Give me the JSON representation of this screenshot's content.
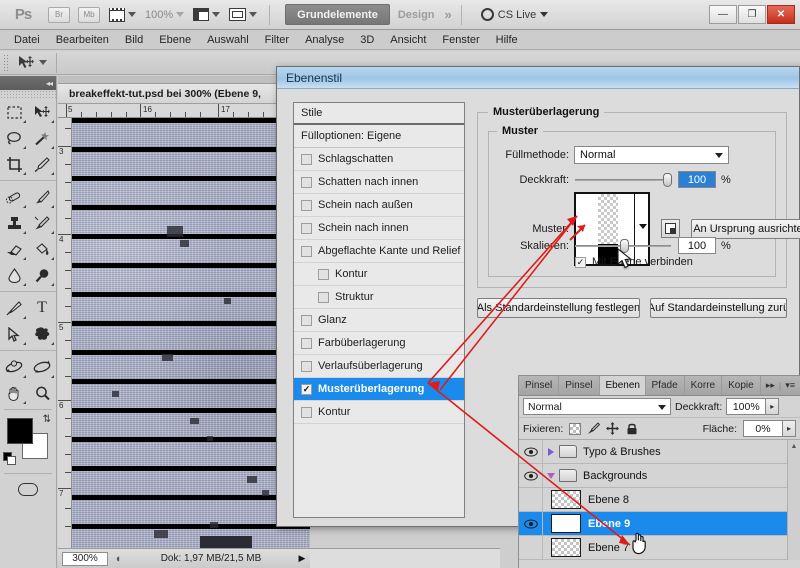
{
  "app": {
    "logo": "Ps",
    "bridge_label": "Br",
    "minibridge_label": "Mb",
    "zoom_label": "100%",
    "workspace_active": "Grundelemente",
    "workspace_other": "Design",
    "workspace_more": "»",
    "cslive_label": "CS Live",
    "win_minimize": "—",
    "win_restore": "❐",
    "win_close": "✕"
  },
  "menubar": {
    "items": [
      "Datei",
      "Bearbeiten",
      "Bild",
      "Ebene",
      "Auswahl",
      "Filter",
      "Analyse",
      "3D",
      "Ansicht",
      "Fenster",
      "Hilfe"
    ]
  },
  "toolbar": {
    "collapse_icon": "◂◂",
    "tools": [
      "rectangular-marquee-tool",
      "move-tool",
      "lasso-tool",
      "magic-wand-tool",
      "crop-tool",
      "eyedropper-tool",
      "spot-healing-brush-tool",
      "brush-tool",
      "clone-stamp-tool",
      "history-brush-tool",
      "eraser-tool",
      "paint-bucket-tool",
      "blur-tool",
      "dodge-tool",
      "pen-tool",
      "horizontal-type-tool",
      "path-selection-tool",
      "custom-shape-tool",
      "3d-rotate-tool",
      "3d-orbit-tool",
      "hand-tool",
      "zoom-tool"
    ],
    "foreground_color": "#000000",
    "background_color": "#ffffff"
  },
  "document": {
    "tab_title": "breakeffekt-tut.psd bei 300% (Ebene 9,",
    "ruler_h_labels": [
      "5",
      "16",
      "17"
    ],
    "ruler_v_labels": [
      "3",
      "4",
      "5",
      "6",
      "7"
    ],
    "zoom_value": "300%",
    "status_text": "Dok: 1,97 MB/21,5 MB",
    "status_arrow": "▶"
  },
  "dialog": {
    "title": "Ebenenstil",
    "styles": {
      "header": "Stile",
      "fill_options": "Fülloptionen: Eigene",
      "items": [
        {
          "label": "Schlagschatten",
          "checked": false,
          "indent": false,
          "selected": false
        },
        {
          "label": "Schatten nach innen",
          "checked": false,
          "indent": false,
          "selected": false
        },
        {
          "label": "Schein nach außen",
          "checked": false,
          "indent": false,
          "selected": false
        },
        {
          "label": "Schein nach innen",
          "checked": false,
          "indent": false,
          "selected": false
        },
        {
          "label": "Abgeflachte Kante und Relief",
          "checked": false,
          "indent": false,
          "selected": false
        },
        {
          "label": "Kontur",
          "checked": false,
          "indent": true,
          "selected": false
        },
        {
          "label": "Struktur",
          "checked": false,
          "indent": true,
          "selected": false
        },
        {
          "label": "Glanz",
          "checked": false,
          "indent": false,
          "selected": false
        },
        {
          "label": "Farbüberlagerung",
          "checked": false,
          "indent": false,
          "selected": false
        },
        {
          "label": "Verlaufsüberlagerung",
          "checked": false,
          "indent": false,
          "selected": false
        },
        {
          "label": "Musterüberlagerung",
          "checked": true,
          "indent": false,
          "selected": true
        },
        {
          "label": "Kontur",
          "checked": false,
          "indent": false,
          "selected": false
        }
      ],
      "checkmark": "✓"
    },
    "pattern_overlay": {
      "group_legend": "Musterüberlagerung",
      "subgroup_legend": "Muster",
      "blend_mode_label": "Füllmethode:",
      "blend_mode_value": "Normal",
      "opacity_label": "Deckkraft:",
      "opacity_value": "100",
      "opacity_unit": "%",
      "pattern_label": "Muster:",
      "new_pattern_icon": "new-pattern-icon",
      "snap_button": "An Ursprung ausrichten",
      "scale_label": "Skalieren:",
      "scale_value": "100",
      "scale_unit": "%",
      "link_layer_label": "Mit Ebene verbinden",
      "link_layer_checked": true
    },
    "buttons": {
      "set_default": "Als Standardeinstellung festlegen",
      "reset_default": "Auf Standardeinstellung zurü"
    }
  },
  "layers_panel": {
    "tabs": [
      {
        "label": "Pinsel",
        "active": false
      },
      {
        "label": "Pinsel",
        "active": false
      },
      {
        "label": "Ebenen",
        "active": true
      },
      {
        "label": "Pfade",
        "active": false
      },
      {
        "label": "Korre",
        "active": false
      },
      {
        "label": "Kopie",
        "active": false
      }
    ],
    "tab_expand": "▸▸",
    "tab_menu": "▾≡",
    "blend_mode": "Normal",
    "opacity_label": "Deckkraft:",
    "opacity_value": "100%",
    "lock_label": "Fixieren:",
    "fill_label": "Fläche:",
    "fill_value": "0%",
    "lock_icons": [
      "lock-transparency-icon",
      "lock-image-icon",
      "lock-position-icon",
      "lock-all-icon"
    ],
    "rows": [
      {
        "name": "Typo & Brushes",
        "type": "group",
        "visible": true,
        "expanded": false,
        "selected": false
      },
      {
        "name": "Backgrounds",
        "type": "group",
        "visible": true,
        "expanded": true,
        "selected": false
      },
      {
        "name": "Ebene 8",
        "type": "layer",
        "visible": false,
        "thumb": "checker",
        "selected": false
      },
      {
        "name": "Ebene 9",
        "type": "layer",
        "visible": true,
        "thumb": "white",
        "selected": true
      },
      {
        "name": "Ebene 7",
        "type": "layer",
        "visible": false,
        "thumb": "checker",
        "selected": false
      }
    ],
    "scroll_up": "▲"
  },
  "annotations": {
    "color": "#e01b1b",
    "arrow_1": "pattern-swatch-callout",
    "arrow_2": "musteruberlagerung-callout",
    "arrow_3": "ebene-9-callout"
  }
}
